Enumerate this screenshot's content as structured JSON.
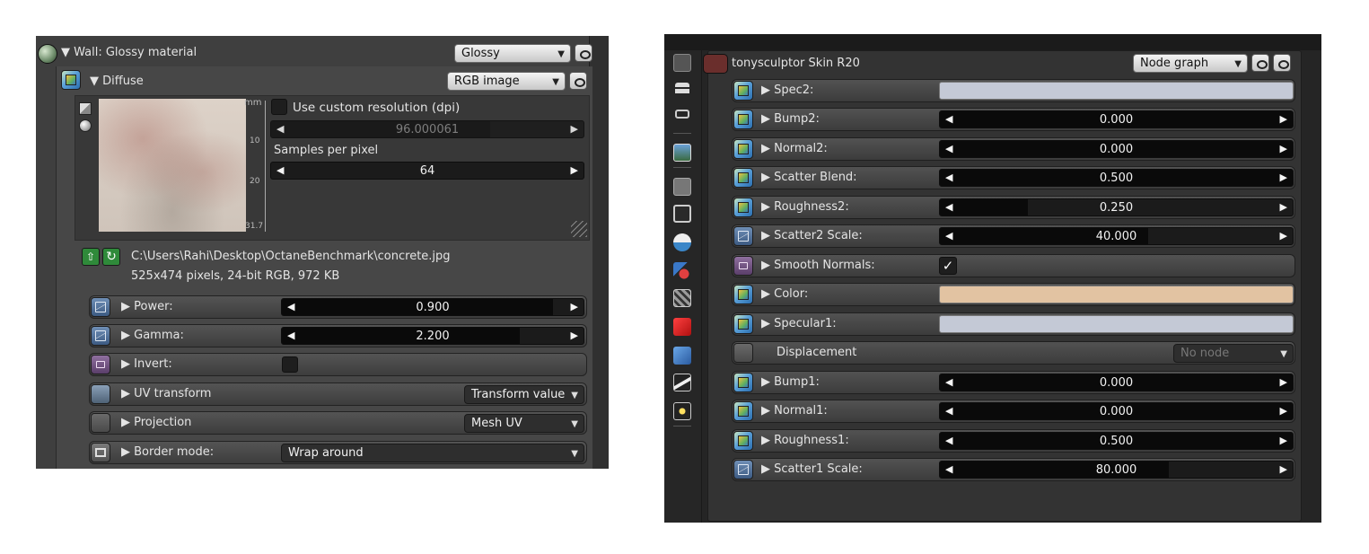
{
  "left": {
    "material": {
      "title": "▼ Wall: Glossy material",
      "type": "Glossy"
    },
    "diffuse": {
      "title": "▼ Diffuse",
      "type": "RGB image"
    },
    "image_panel": {
      "ruler": {
        "unit": "mm",
        "ticks": [
          "10",
          "20",
          "31.7"
        ]
      },
      "custom_resolution": {
        "label": "Use custom resolution (dpi)",
        "checked": false,
        "value": "96.000061"
      },
      "samples": {
        "label": "Samples per pixel",
        "value": "64"
      }
    },
    "file": {
      "path": "C:\\Users\\Rahi\\Desktop\\OctaneBenchmark\\concrete.jpg",
      "info": "525x474 pixels, 24-bit RGB, 972 KB"
    },
    "params": [
      {
        "label": "▶ Power:",
        "value": "0.900",
        "fill": 0.9
      },
      {
        "label": "▶ Gamma:",
        "value": "2.200",
        "fill": 0.79
      },
      {
        "label": "▶ Invert:",
        "checked": false
      },
      {
        "label": "▶ UV transform",
        "dropdown": "Transform value"
      },
      {
        "label": "▶ Projection",
        "dropdown": "Mesh UV"
      },
      {
        "label": "▶ Border mode:",
        "dropdown": "Wrap around"
      }
    ]
  },
  "right": {
    "header": {
      "title": "tonysculptor Skin R20",
      "type": "Node graph",
      "color": "#6a2e2c"
    },
    "rows": [
      {
        "label": "▶ Spec2:",
        "swatch": "#c4c9d6"
      },
      {
        "label": "▶ Bump2:",
        "value": "0.000",
        "fill": 1.0
      },
      {
        "label": "▶ Normal2:",
        "value": "0.000",
        "fill": 1.0
      },
      {
        "label": "▶ Scatter Blend:",
        "value": "0.500",
        "fill": 1.0
      },
      {
        "label": "▶ Roughness2:",
        "value": "0.250",
        "fill": 0.25
      },
      {
        "label": "▶ Scatter2 Scale:",
        "value": "40.000",
        "fill": 0.59
      },
      {
        "label": "▶ Smooth Normals:",
        "checked": true,
        "check_glyph": "✓"
      },
      {
        "label": "▶ Color:",
        "swatch": "#e2c3a2"
      },
      {
        "label": "▶ Specular1:",
        "swatch": "#c4c9d6"
      },
      {
        "label": "Displacement",
        "dropdown": "No node"
      },
      {
        "label": "▶ Bump1:",
        "value": "0.000",
        "fill": 1.0
      },
      {
        "label": "▶ Normal1:",
        "value": "0.000",
        "fill": 1.0
      },
      {
        "label": "▶ Roughness1:",
        "value": "0.500",
        "fill": 1.0
      },
      {
        "label": "▶ Scatter1 Scale:",
        "value": "80.000",
        "fill": 0.65
      }
    ],
    "toolbar_icons": [
      "camera-icon",
      "layers-icon",
      "objects-icon",
      "image-icon",
      "render-camera-icon",
      "monitor-icon",
      "environment-icon",
      "paint-icon",
      "texture-icon",
      "red-cube-icon",
      "blue-cube-icon",
      "mountain-icon",
      "light-icon"
    ]
  }
}
